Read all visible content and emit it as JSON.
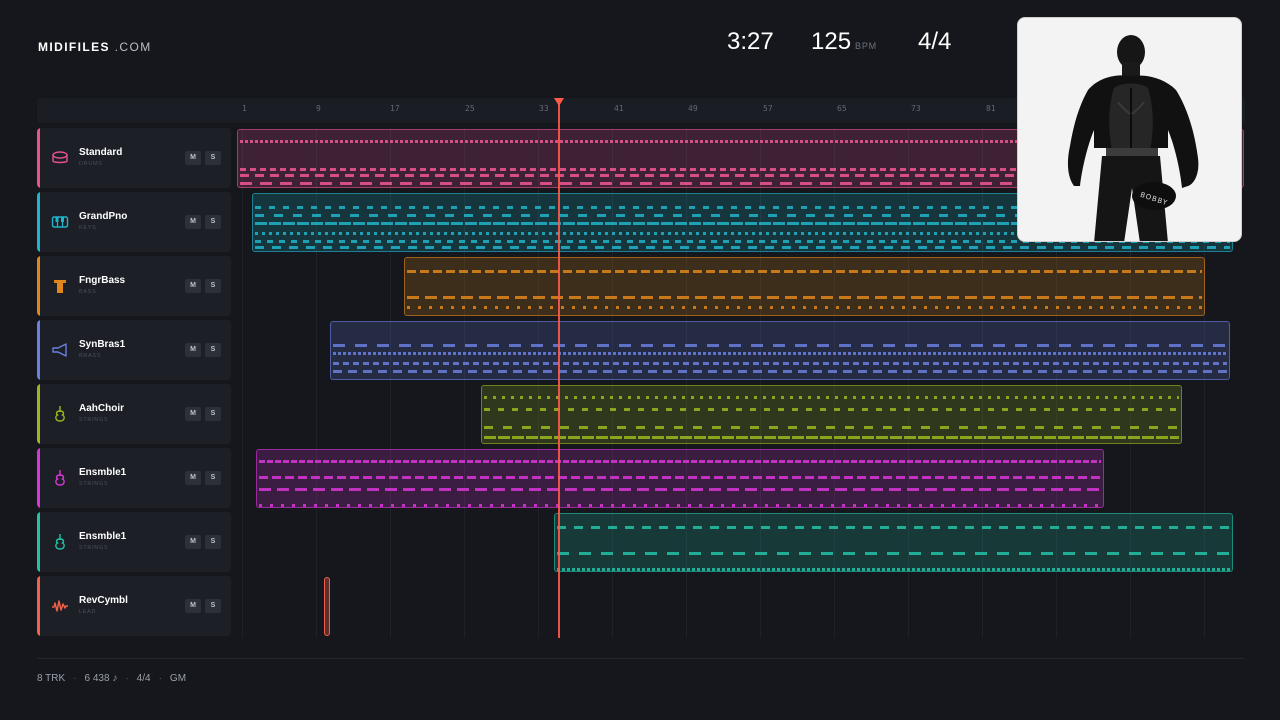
{
  "brand": {
    "name": "MIDIFILES",
    "domain": ".COM"
  },
  "stats": {
    "time": "3:27",
    "tempo": "125",
    "tempo_unit": "BPM",
    "signature": "4/4"
  },
  "ruler": {
    "ticks": [
      "1",
      "9",
      "17",
      "25",
      "33",
      "41",
      "49",
      "57",
      "65",
      "73",
      "81"
    ]
  },
  "colors": {
    "playhead": "#ff5a4a",
    "background": "#15171c"
  },
  "tracks": [
    {
      "name": "Standard",
      "category": "DRUMS",
      "color": "#e8528f",
      "icon": "drum-icon",
      "mute": "M",
      "solo": "S"
    },
    {
      "name": "GrandPno",
      "category": "KEYS",
      "color": "#1fb4c9",
      "icon": "piano-icon",
      "mute": "M",
      "solo": "S"
    },
    {
      "name": "FngrBass",
      "category": "BASS",
      "color": "#e0861a",
      "icon": "bass-icon",
      "mute": "M",
      "solo": "S"
    },
    {
      "name": "SynBras1",
      "category": "BRASS",
      "color": "#6a7fe0",
      "icon": "horn-icon",
      "mute": "M",
      "solo": "S"
    },
    {
      "name": "AahChoir",
      "category": "STRINGS",
      "color": "#9bb81e",
      "icon": "violin-icon",
      "mute": "M",
      "solo": "S"
    },
    {
      "name": "Ensmble1",
      "category": "STRINGS",
      "color": "#d936d9",
      "icon": "violin-icon",
      "mute": "M",
      "solo": "S"
    },
    {
      "name": "Ensmble1",
      "category": "STRINGS",
      "color": "#23c2a8",
      "icon": "violin-icon",
      "mute": "M",
      "solo": "S"
    },
    {
      "name": "RevCymbl",
      "category": "LEAD",
      "color": "#f0604a",
      "icon": "waveform-icon",
      "mute": "M",
      "solo": "S"
    }
  ],
  "footer": {
    "tracks": "8 TRK",
    "notes": "6 438 ♪",
    "signature": "4/4",
    "standard": "GM"
  },
  "album_cover": {
    "lettering": "BOBBY"
  }
}
